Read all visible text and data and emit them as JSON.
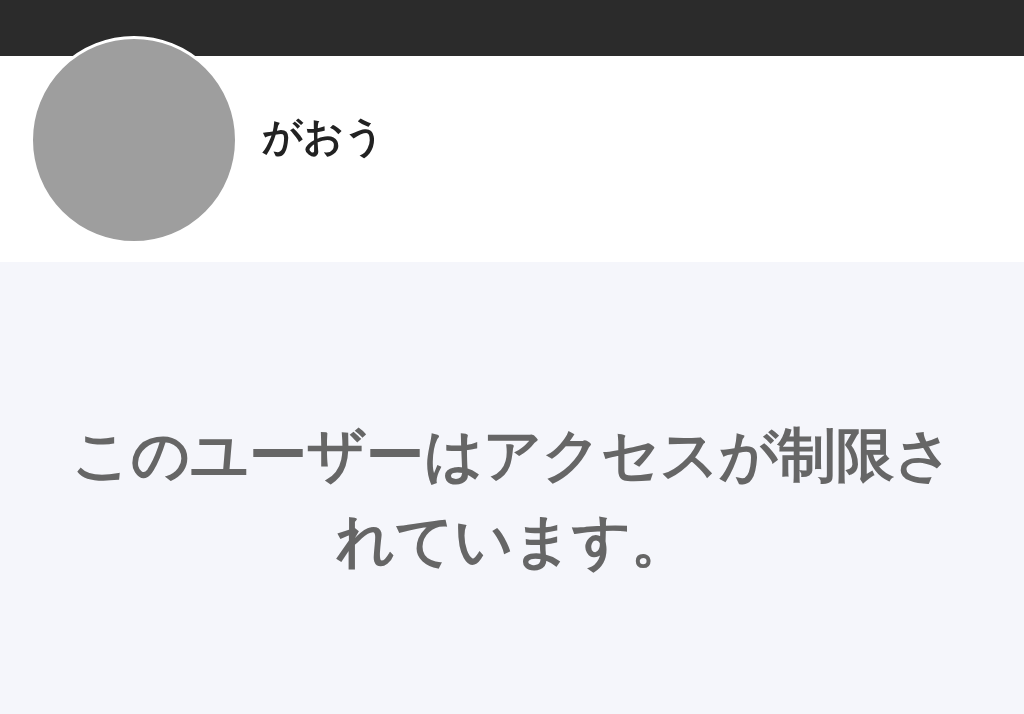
{
  "profile": {
    "name": "がおう"
  },
  "notice": {
    "message": "このユーザーはアクセスが制限されています。"
  }
}
